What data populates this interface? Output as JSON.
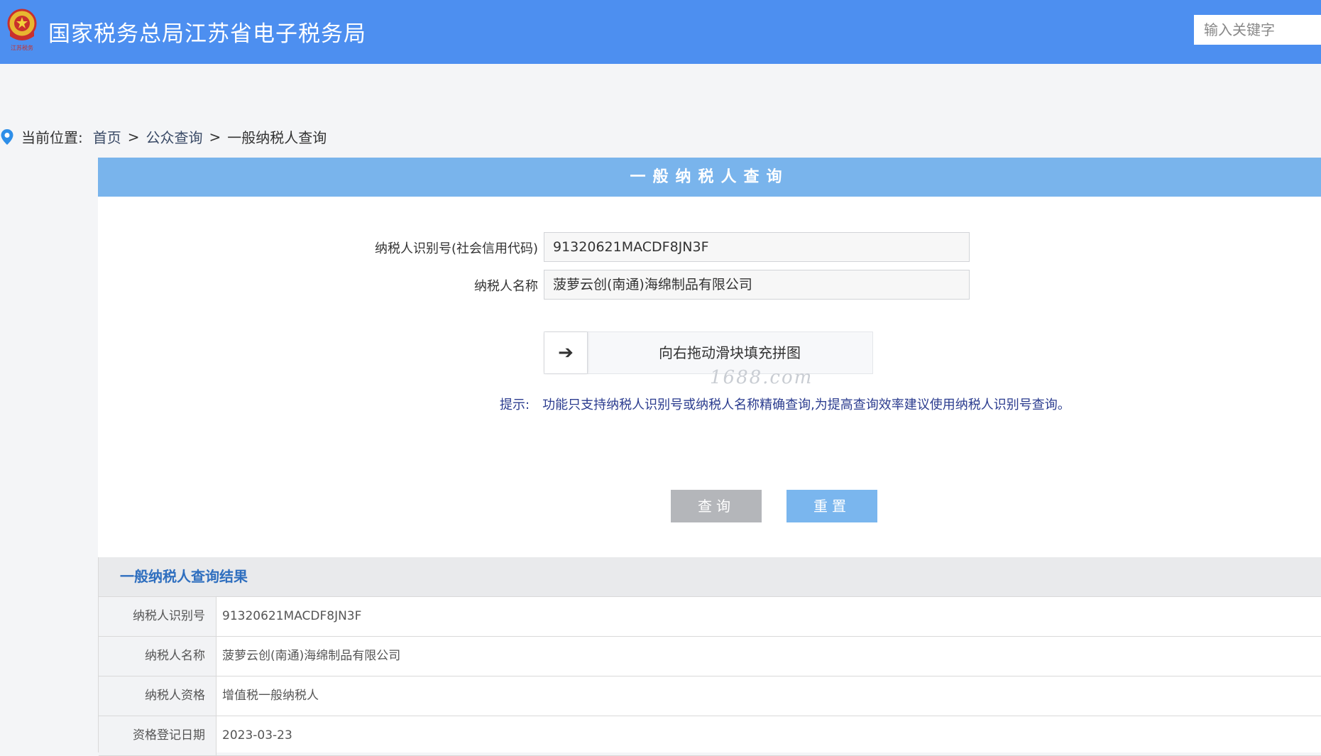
{
  "header": {
    "title": "国家税务总局江苏省电子税务局",
    "logo_text": "江苏税务",
    "search_placeholder": "输入关键字"
  },
  "breadcrumb": {
    "label": "当前位置:",
    "items": [
      "首页",
      "公众查询",
      "一般纳税人查询"
    ],
    "separator": ">"
  },
  "query_panel": {
    "title": "一般纳税人查询",
    "taxpayer_id_label": "纳税人识别号(社会信用代码)",
    "taxpayer_id_value": "91320621MACDF8JN3F",
    "taxpayer_name_label": "纳税人名称",
    "taxpayer_name_value": "菠萝云创(南通)海绵制品有限公司",
    "slider_text": "向右拖动滑块填充拼图",
    "slider_arrow": "➔",
    "watermark": "1688.com",
    "hint_label": "提示:",
    "hint_text": "功能只支持纳税人识别号或纳税人名称精确查询,为提高查询效率建议使用纳税人识别号查询。",
    "query_button": "查询",
    "reset_button": "重置"
  },
  "results": {
    "title": "一般纳税人查询结果",
    "rows": [
      {
        "key": "纳税人识别号",
        "value": "91320621MACDF8JN3F"
      },
      {
        "key": "纳税人名称",
        "value": "菠萝云创(南通)海绵制品有限公司"
      },
      {
        "key": "纳税人资格",
        "value": "增值税一般纳税人"
      },
      {
        "key": "资格登记日期",
        "value": "2023-03-23"
      }
    ]
  },
  "colors": {
    "topbar": "#4d8ff0",
    "panel_header": "#79b4ec",
    "hint_text": "#2b3c8f",
    "query_button": "#b4b6ba",
    "reset_button": "#7ab6ee",
    "result_title": "#2f6fbf"
  }
}
